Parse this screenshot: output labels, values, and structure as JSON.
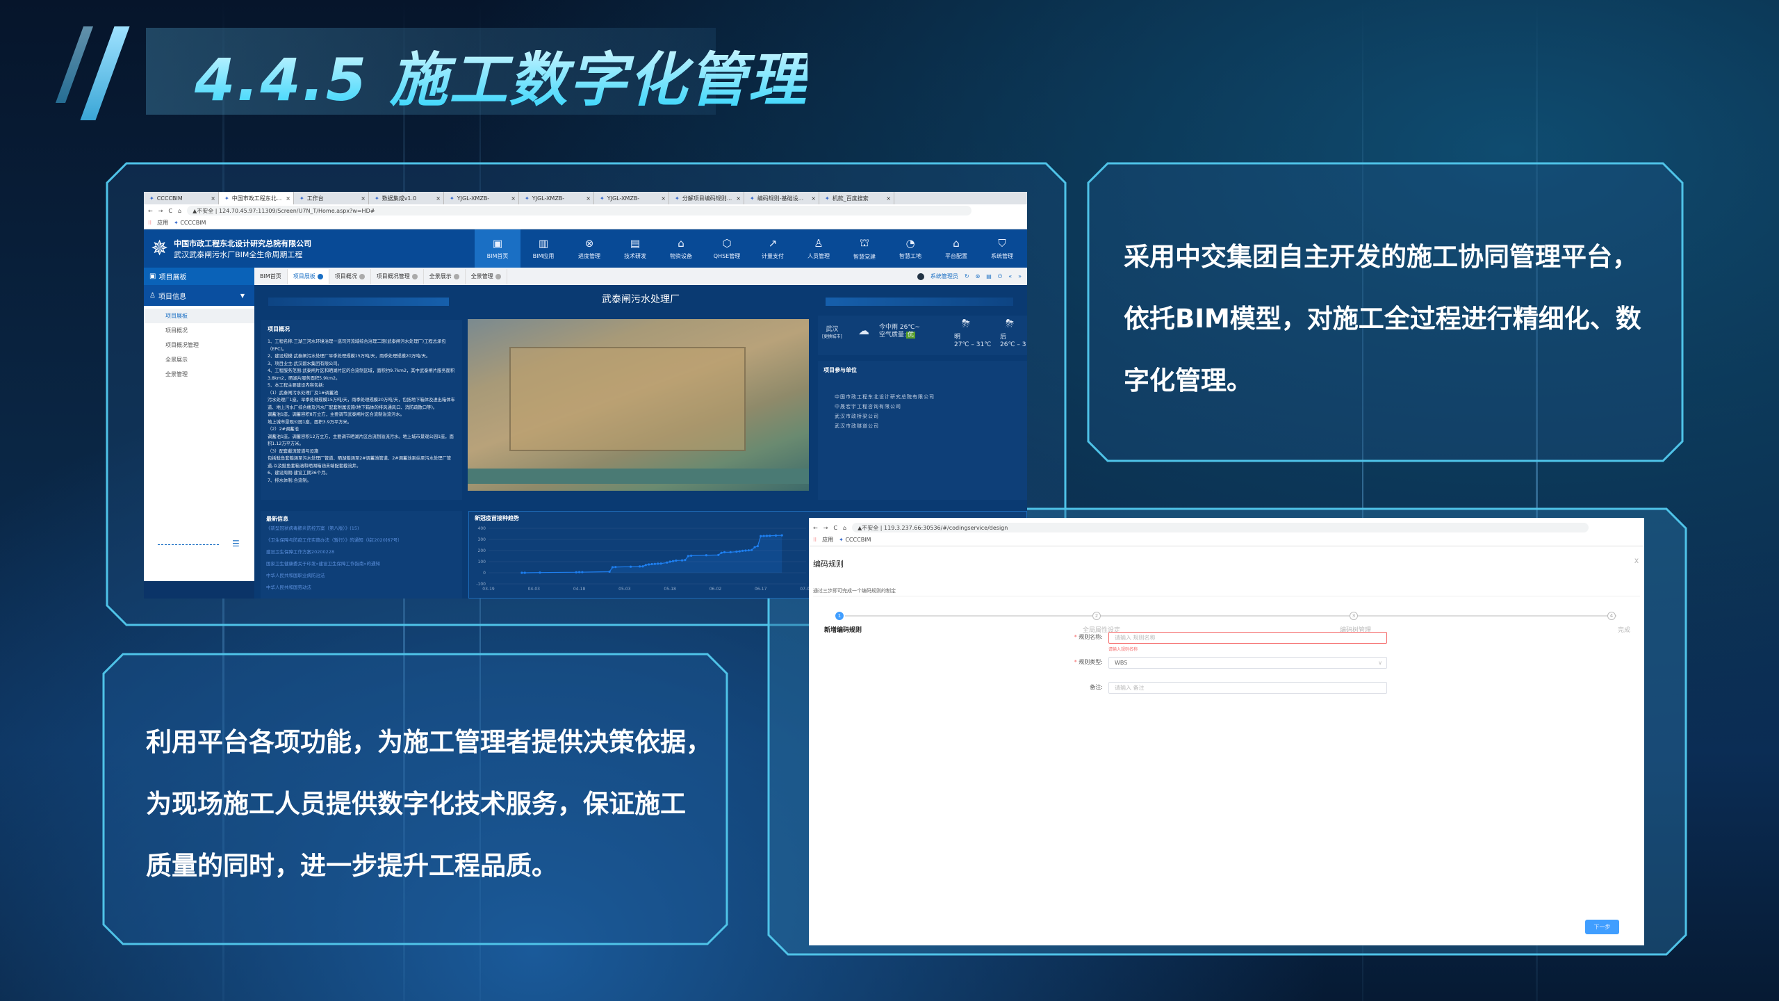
{
  "slide": {
    "title": "4.4.5 施工数字化管理",
    "right_text": [
      "采用中交集团自主开发的施工协同管理平台，",
      "依托BIM模型，对施工全过程进行精细化、数",
      "字化管理。"
    ],
    "left_text": [
      "利用平台各项功能，为施工管理者提供决策依据，",
      "为现场施工人员提供数字化技术服务，保证施工",
      "质量的同时，进一步提升工程品质。"
    ],
    "accent": "#4fc3e8"
  },
  "left_browser": {
    "tabs": [
      "CCCCBIM",
      "中国市政工程东北...",
      "工作台",
      "数据集成v1.0",
      "YJGL-XMZB-",
      "YJGL-XMZB-",
      "YJGL-XMZB-",
      "分解项目编码规则...",
      "编码规则-基础设...",
      "机款_百度搜索"
    ],
    "insecure": "不安全",
    "url": "124.70.45.97:11309/Screen/U7N_T/Home.aspx?w=HD#",
    "bookmarks": [
      "应用",
      "CCCCBIM"
    ],
    "company": "中国市政工程东北设计研究总院有限公司",
    "project": "武汉武泰闸污水厂BIM全生命周期工程",
    "nav": [
      {
        "label": "BIM首页",
        "icon": "▣"
      },
      {
        "label": "BIM应用",
        "icon": "▥"
      },
      {
        "label": "进度管理",
        "icon": "⊗"
      },
      {
        "label": "技术研发",
        "icon": "▤"
      },
      {
        "label": "物资设备",
        "icon": "⌂"
      },
      {
        "label": "QHSE管理",
        "icon": "⬡"
      },
      {
        "label": "计量支付",
        "icon": "↗"
      },
      {
        "label": "人员管理",
        "icon": "♙"
      },
      {
        "label": "智慧党建",
        "icon": "⛫"
      },
      {
        "label": "智慧工地",
        "icon": "◔"
      },
      {
        "label": "平台配置",
        "icon": "⌂"
      },
      {
        "label": "系统管理",
        "icon": "⛉"
      }
    ],
    "page_tabs": [
      "BIM首页",
      "项目展板",
      "项目概况",
      "项目概况管理",
      "全景展示",
      "全景管理"
    ],
    "user": "系统管理员",
    "sidebar": {
      "head": "项目展板",
      "group": "项目信息",
      "items": [
        "项目展板",
        "项目概况",
        "项目概况管理",
        "全景展示",
        "全景管理"
      ]
    },
    "page_title": "武泰闸污水处理厂",
    "overview": {
      "title": "项目概况",
      "lines": [
        "1、工程名称:三湖三河水环境治理一巡司河流域综合治理二期(武泰闸污水处理厂)工程总承包（EPC)。",
        "2、建设规模:武泰闸污水处理厂旱季处理规模15万吨/天，雨季处理规模20万吨/天。",
        "3、项目业主:武汉碧水集团有限公司。",
        "4、工程服务范围:武泰闸片区和晒湖片区的合流制区域，面积约9.7km2，其中武泰闸片服务面积3.8km2，晒湖片服务面积5.9km2。",
        "5、本工程主要建设内容包括:",
        "（1）武泰闸污水处理厂及1#调蓄池",
        "污水处理厂1座，旱季处理规模15万吨/天，雨季处理规模20万吨/天，包括地下箱体及进出箱体车道、地上污水厂综合楼及污水厂配套附属设施(地下箱体的排风通风口、消防疏散口等)。",
        "调蓄池1座，调蓄容积8万立方，主要调节武泰闸片区合流制溢流污水。",
        "地上城市景观公园1座，面积3.9万平方米。",
        "（2）2#调蓄池",
        "调蓄池1座，调蓄容积12万立方，主要调节晒湖片区合流制溢流污水。地上城市景观公园1座，面积1.12万平方米。",
        "（3）配套截流管道与设施",
        "包括鲶鱼套箱涵至污水处理厂管道、晒湖箱涵至2#调蓄池管道、2#调蓄池泵站至污水处理厂管道,以及鲶鱼套箱涵和晒湖箱涵末端配套截流井。",
        "6、建设周期:建设工期36个月。",
        "7、排水体制:合流制。"
      ]
    },
    "weather": {
      "city": "武汉",
      "change_city": "[更换城市]",
      "today": "今中雨 26℃~",
      "aqi_label": "空气质量:",
      "aqi": "优",
      "tomorrow": "明",
      "tomorrow_temp": "27℃ – 31℃",
      "after": "后",
      "after_temp": "26℃ – 3"
    },
    "units": {
      "title": "项目参与单位",
      "items": [
        "中国市政工程东北设计研究总院有限公司",
        "中晟宏宇工程咨询有限公司",
        "武汉市政桥梁公司",
        "武汉市政隧道公司"
      ]
    },
    "news": {
      "title": "最新信息",
      "items": [
        "《新型冠状病毒肺炎防控方案（第八版）》(15)",
        "《卫生保障与防疫工作实施办法（暂行）》的通知（综[2020]67号）",
        "建设卫生保障工作方案20200228",
        "国家卫生健康委关于印发«建设卫生保障工作指南»的通知",
        "中华人民共和国职业病防治法",
        "中华人民共和国劳动法"
      ]
    }
  },
  "chart_data": {
    "type": "line",
    "title": "新冠疫苗接种趋势",
    "ylim": [
      -100,
      400
    ],
    "yticks": [
      400,
      300,
      200,
      100,
      0,
      -100
    ],
    "xticks": [
      "03-19",
      "04-03",
      "04-18",
      "05-03",
      "05-18",
      "06-02",
      "06-17",
      "07-02"
    ],
    "grid": true,
    "color": "#1e7ff0",
    "points": [
      [
        "03-30",
        0
      ],
      [
        "03-31",
        0
      ],
      [
        "04-05",
        2
      ],
      [
        "04-17",
        5
      ],
      [
        "04-18",
        6
      ],
      [
        "04-19",
        6
      ],
      [
        "04-28",
        10
      ],
      [
        "04-29",
        50
      ],
      [
        "04-30",
        52
      ],
      [
        "05-05",
        55
      ],
      [
        "05-08",
        57
      ],
      [
        "05-09",
        58
      ],
      [
        "05-10",
        70
      ],
      [
        "05-11",
        75
      ],
      [
        "05-12",
        78
      ],
      [
        "05-13",
        80
      ],
      [
        "05-14",
        82
      ],
      [
        "05-15",
        83
      ],
      [
        "05-17",
        92
      ],
      [
        "05-18",
        100
      ],
      [
        "05-19",
        105
      ],
      [
        "05-20",
        110
      ],
      [
        "05-22",
        112
      ],
      [
        "05-23",
        115
      ],
      [
        "05-24",
        150
      ],
      [
        "05-25",
        154
      ],
      [
        "05-30",
        158
      ],
      [
        "06-03",
        160
      ],
      [
        "06-04",
        180
      ],
      [
        "06-05",
        185
      ],
      [
        "06-07",
        185
      ],
      [
        "06-09",
        190
      ],
      [
        "06-10",
        193
      ],
      [
        "06-11",
        198
      ],
      [
        "06-12",
        200
      ],
      [
        "06-13",
        202
      ],
      [
        "06-14",
        205
      ],
      [
        "06-15",
        230
      ],
      [
        "06-16",
        240
      ],
      [
        "06-17",
        330
      ],
      [
        "06-18",
        331
      ],
      [
        "06-19",
        332
      ],
      [
        "06-20",
        333
      ],
      [
        "06-22",
        335
      ],
      [
        "06-24",
        337
      ]
    ]
  },
  "right_browser": {
    "insecure": "不安全",
    "url": "119.3.237.66:30536/#/codingservice/design",
    "bookmarks": [
      "应用",
      "CCCCBIM"
    ],
    "title": "编码规则",
    "close": "X",
    "subtitle": "通过三步即可完成一个编码规则的制定",
    "steps": [
      {
        "num": "1",
        "label": "新增编码规则"
      },
      {
        "num": "2",
        "label": "全局属性设定"
      },
      {
        "num": "3",
        "label": "编码树管理"
      },
      {
        "num": "4",
        "label": "完成"
      }
    ],
    "form": {
      "name_label": "规则名称:",
      "name_placeholder": "请输入 规则名称",
      "name_error": "请输入规则名称",
      "type_label": "规则类型:",
      "type_value": "WBS",
      "remark_label": "备注:",
      "remark_placeholder": "请输入 备注"
    },
    "next": "下一步"
  }
}
